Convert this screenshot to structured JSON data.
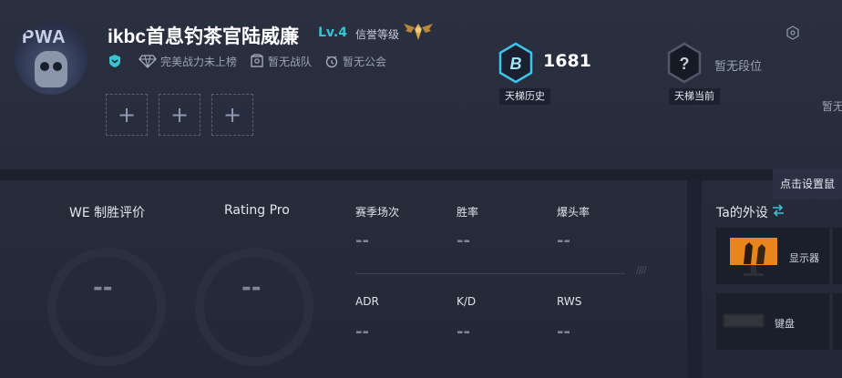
{
  "profile": {
    "avatar_text": "PWA",
    "nickname": "ikbc首息钓茶官陆威廉",
    "level": "Lv.4",
    "credit_label": "信誉等级",
    "credit_badge_icon": "golden-wings-badge",
    "tags": [
      {
        "icon": "team-shield-icon",
        "label": ""
      },
      {
        "icon": "diamond-icon",
        "label": "完美战力未上榜"
      },
      {
        "icon": "team-icon",
        "label": "暂无战队"
      },
      {
        "icon": "guild-icon",
        "label": "暂无公会"
      }
    ],
    "slots": [
      "+",
      "+",
      "+"
    ]
  },
  "ranks": {
    "history": {
      "icon": "B",
      "value": "1681",
      "label": "天梯历史"
    },
    "current": {
      "icon": "?",
      "text": "暂无段位",
      "label": "天梯当前"
    },
    "truncated_right": "暂无"
  },
  "tooltip": "点击设置鼠",
  "evaluation": [
    {
      "label": "WE 制胜评价",
      "value": "--"
    },
    {
      "label": "Rating Pro",
      "value": "--"
    }
  ],
  "stats": [
    {
      "label": "赛季场次",
      "value": "--"
    },
    {
      "label": "胜率",
      "value": "--"
    },
    {
      "label": "爆头率",
      "value": "--"
    },
    {
      "label": "ADR",
      "value": "--"
    },
    {
      "label": "K/D",
      "value": "--"
    },
    {
      "label": "RWS",
      "value": "--"
    }
  ],
  "gear": {
    "title": "Ta的外设",
    "items": [
      {
        "name": "显示器",
        "icon": "monitor-icon"
      },
      {
        "name": "键盘",
        "icon": "keyboard-icon"
      }
    ]
  },
  "colors": {
    "accent_cyan": "#39c3d2",
    "background": "#1d2230",
    "panel": "#262b39"
  }
}
